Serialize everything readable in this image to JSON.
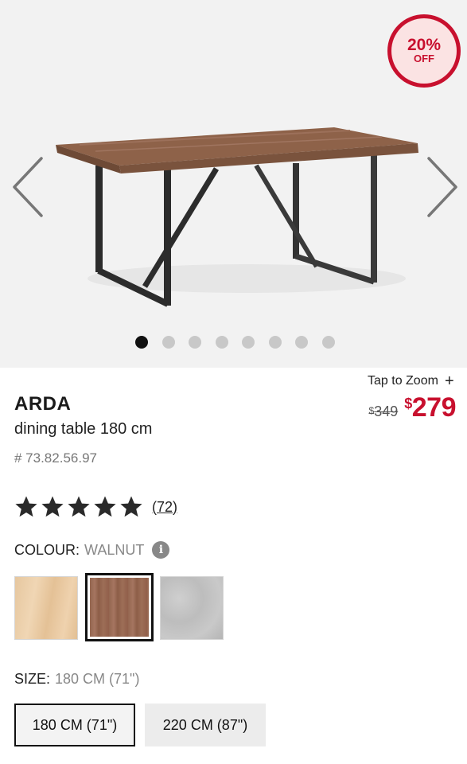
{
  "gallery": {
    "badge": {
      "percent": "20%",
      "label": "OFF"
    },
    "image_count": 8,
    "active_index": 0
  },
  "zoom": {
    "label": "Tap to Zoom",
    "icon": "+"
  },
  "price": {
    "old_currency": "$",
    "old_amount": "349",
    "new_currency": "$",
    "new_amount": "279",
    "sale_color": "#c8102e"
  },
  "product": {
    "name": "ARDA",
    "description": "dining table 180 cm",
    "sku": "# 73.82.56.97"
  },
  "rating": {
    "stars": 5,
    "count": "(72)"
  },
  "colour": {
    "label": "COLOUR:",
    "selected": "WALNUT",
    "options": [
      "oak",
      "walnut",
      "concrete"
    ]
  },
  "size": {
    "label": "SIZE:",
    "selected": "180 CM (71\")",
    "options": [
      "180 CM (71\")",
      "220 CM (87\")"
    ]
  }
}
